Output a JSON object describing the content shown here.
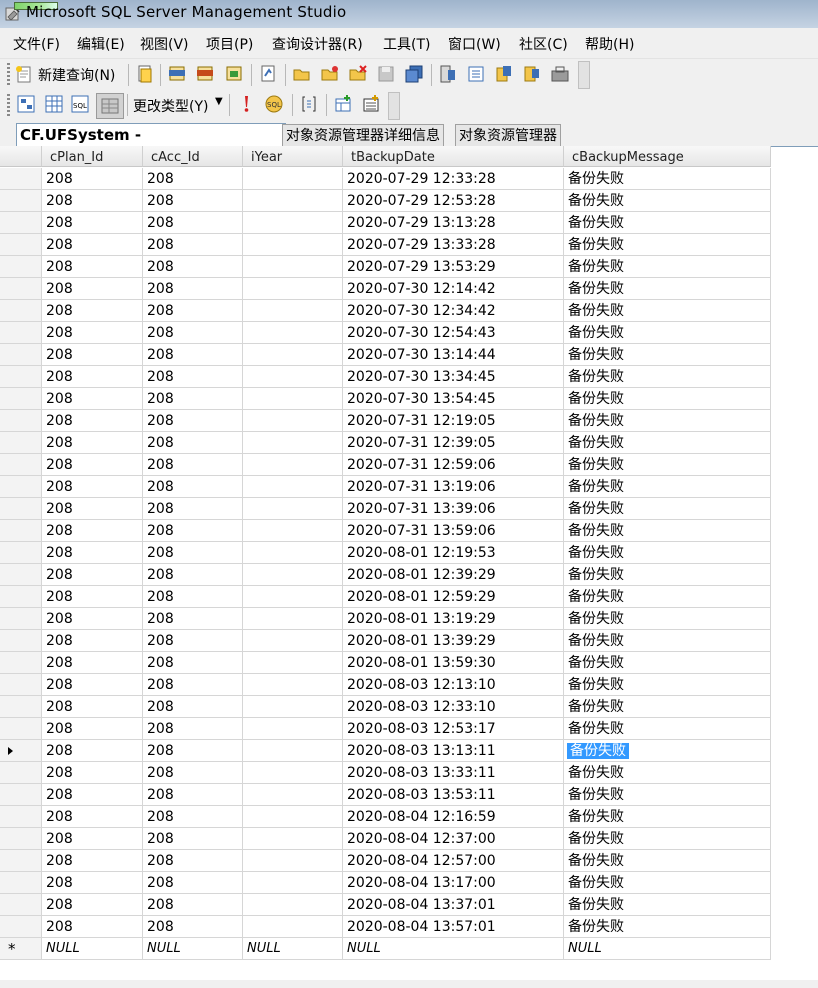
{
  "window": {
    "title": "Microsoft SQL Server Management Studio"
  },
  "menu": [
    "文件(F)",
    "编辑(E)",
    "视图(V)",
    "项目(P)",
    "查询设计器(R)",
    "工具(T)",
    "窗口(W)",
    "社区(C)",
    "帮助(H)"
  ],
  "toolbar": {
    "new_query_label": "新建查询(N)",
    "change_type_label": "更改类型(Y)"
  },
  "tabs": {
    "active": "CF.UFSystem - dbo.UA_BackupLog",
    "object_explorer_details": "对象资源管理器详细信息",
    "object_explorer": "对象资源管理器"
  },
  "grid": {
    "columns": [
      "cPlan_Id",
      "cAcc_Id",
      "iYear",
      "tBackupDate",
      "cBackupMessage"
    ],
    "current_row_index": 26,
    "rows": [
      [
        "208",
        "208",
        "",
        "2020-07-29 12:33:28",
        "备份失败"
      ],
      [
        "208",
        "208",
        "",
        "2020-07-29 12:53:28",
        "备份失败"
      ],
      [
        "208",
        "208",
        "",
        "2020-07-29 13:13:28",
        "备份失败"
      ],
      [
        "208",
        "208",
        "",
        "2020-07-29 13:33:28",
        "备份失败"
      ],
      [
        "208",
        "208",
        "",
        "2020-07-29 13:53:29",
        "备份失败"
      ],
      [
        "208",
        "208",
        "",
        "2020-07-30 12:14:42",
        "备份失败"
      ],
      [
        "208",
        "208",
        "",
        "2020-07-30 12:34:42",
        "备份失败"
      ],
      [
        "208",
        "208",
        "",
        "2020-07-30 12:54:43",
        "备份失败"
      ],
      [
        "208",
        "208",
        "",
        "2020-07-30 13:14:44",
        "备份失败"
      ],
      [
        "208",
        "208",
        "",
        "2020-07-30 13:34:45",
        "备份失败"
      ],
      [
        "208",
        "208",
        "",
        "2020-07-30 13:54:45",
        "备份失败"
      ],
      [
        "208",
        "208",
        "",
        "2020-07-31 12:19:05",
        "备份失败"
      ],
      [
        "208",
        "208",
        "",
        "2020-07-31 12:39:05",
        "备份失败"
      ],
      [
        "208",
        "208",
        "",
        "2020-07-31 12:59:06",
        "备份失败"
      ],
      [
        "208",
        "208",
        "",
        "2020-07-31 13:19:06",
        "备份失败"
      ],
      [
        "208",
        "208",
        "",
        "2020-07-31 13:39:06",
        "备份失败"
      ],
      [
        "208",
        "208",
        "",
        "2020-07-31 13:59:06",
        "备份失败"
      ],
      [
        "208",
        "208",
        "",
        "2020-08-01 12:19:53",
        "备份失败"
      ],
      [
        "208",
        "208",
        "",
        "2020-08-01 12:39:29",
        "备份失败"
      ],
      [
        "208",
        "208",
        "",
        "2020-08-01 12:59:29",
        "备份失败"
      ],
      [
        "208",
        "208",
        "",
        "2020-08-01 13:19:29",
        "备份失败"
      ],
      [
        "208",
        "208",
        "",
        "2020-08-01 13:39:29",
        "备份失败"
      ],
      [
        "208",
        "208",
        "",
        "2020-08-01 13:59:30",
        "备份失败"
      ],
      [
        "208",
        "208",
        "",
        "2020-08-03 12:13:10",
        "备份失败"
      ],
      [
        "208",
        "208",
        "",
        "2020-08-03 12:33:10",
        "备份失败"
      ],
      [
        "208",
        "208",
        "",
        "2020-08-03 12:53:17",
        "备份失败"
      ],
      [
        "208",
        "208",
        "",
        "2020-08-03 13:13:11",
        "备份失败"
      ],
      [
        "208",
        "208",
        "",
        "2020-08-03 13:33:11",
        "备份失败"
      ],
      [
        "208",
        "208",
        "",
        "2020-08-03 13:53:11",
        "备份失败"
      ],
      [
        "208",
        "208",
        "",
        "2020-08-04 12:16:59",
        "备份失败"
      ],
      [
        "208",
        "208",
        "",
        "2020-08-04 12:37:00",
        "备份失败"
      ],
      [
        "208",
        "208",
        "",
        "2020-08-04 12:57:00",
        "备份失败"
      ],
      [
        "208",
        "208",
        "",
        "2020-08-04 13:17:00",
        "备份失败"
      ],
      [
        "208",
        "208",
        "",
        "2020-08-04 13:37:01",
        "备份失败"
      ],
      [
        "208",
        "208",
        "",
        "2020-08-04 13:57:01",
        "备份失败"
      ]
    ],
    "new_row": [
      "NULL",
      "NULL",
      "NULL",
      "NULL",
      "NULL"
    ],
    "new_row_marker": "*"
  },
  "colors": {
    "selection": "#3399ff",
    "titlebar": "#b3c5d9",
    "chrome": "#f0f0f0"
  }
}
